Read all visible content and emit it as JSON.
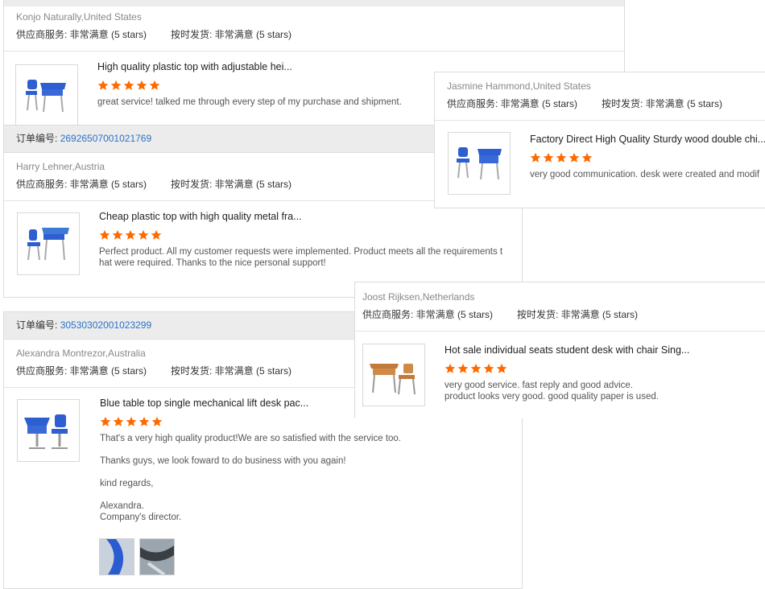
{
  "colors": {
    "accent_link": "#2a72c9",
    "star": "#ff6a00",
    "header_bg": "#ececec"
  },
  "order_label": "订单编号:",
  "reviews": [
    {
      "buyer": "Konjo Naturally,United States",
      "supplier_service": "供应商服务: 非常满意  (5 stars)",
      "shipping": "按时发货: 非常满意  (5 stars)",
      "title": "High quality plastic top with adjustable hei...",
      "rating": 5,
      "comment": "great service! talked me through every step of my purchase and shipment."
    },
    {
      "order_number": "26926507001021769",
      "buyer": "Harry Lehner,Austria",
      "supplier_service": "供应商服务: 非常满意  (5 stars)",
      "shipping": "按时发货: 非常满意  (5 stars)",
      "title": "Cheap plastic top with high quality metal fra...",
      "rating": 5,
      "comment_line1": "Perfect product. All my customer requests were implemented. Product meets all the requirements t",
      "comment_line2": "hat were required. Thanks to the nice personal support!"
    },
    {
      "order_number": "30530302001023299",
      "buyer": "Alexandra Montrezor,Australia",
      "supplier_service": "供应商服务: 非常满意  (5 stars)",
      "shipping": "按时发货: 非常满意  (5 stars)",
      "title": "Blue table top single mechanical lift desk pac...",
      "rating": 5,
      "comment_p1": "That's a very high quality product!We are so satisfied with the service too.",
      "comment_p2": "Thanks guys, we look foward to do business with you again!",
      "comment_p3": "kind regards,",
      "comment_p4a": "Alexandra.",
      "comment_p4b": "Company's director."
    },
    {
      "buyer": "Jasmine Hammond,United States",
      "supplier_service": "供应商服务: 非常满意  (5 stars)",
      "shipping": "按时发货: 非常满意  (5 stars)",
      "title": "Factory Direct High Quality Sturdy wood double chi...",
      "rating": 5,
      "comment": "very good communication. desk were created and modif"
    },
    {
      "buyer": "Joost Rijksen,Netherlands",
      "supplier_service": "供应商服务: 非常满意  (5 stars)",
      "shipping": "按时发货: 非常满意  (5 stars)",
      "title": "Hot sale individual seats student desk with chair Sing...",
      "rating": 5,
      "comment_line1": "very good service. fast reply and good advice.",
      "comment_line2": "product looks very good. good quality paper is used."
    }
  ]
}
